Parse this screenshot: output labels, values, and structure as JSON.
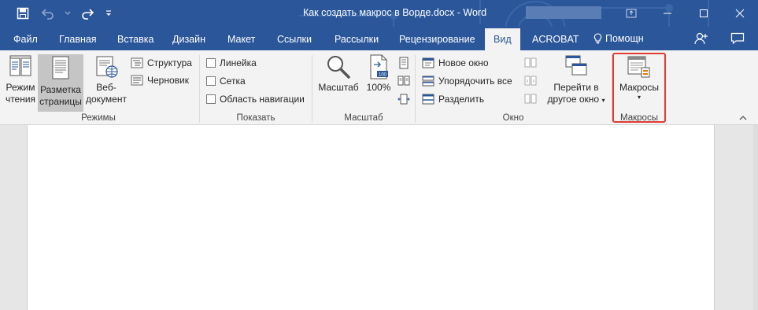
{
  "app": {
    "title": "Как создать макрос в Ворде.docx - Word"
  },
  "quick_access": {
    "icons": [
      "save-icon",
      "undo-icon",
      "undo-dropdown-icon",
      "redo-icon",
      "customize-qat-icon"
    ]
  },
  "window_controls": {
    "icons": [
      "ribbon-display-options-icon",
      "minimize-icon",
      "maximize-icon",
      "close-icon"
    ]
  },
  "tabs": [
    {
      "label": "Файл",
      "active": false
    },
    {
      "label": "Главная",
      "active": false
    },
    {
      "label": "Вставка",
      "active": false
    },
    {
      "label": "Дизайн",
      "active": false
    },
    {
      "label": "Макет",
      "active": false
    },
    {
      "label": "Ссылки",
      "active": false
    },
    {
      "label": "Рассылки",
      "active": false
    },
    {
      "label": "Рецензирование",
      "active": false
    },
    {
      "label": "Вид",
      "active": true
    },
    {
      "label": "ACROBAT",
      "active": false
    }
  ],
  "tell_me": {
    "label": "Помощн",
    "icon": "lightbulb-icon"
  },
  "ribbon": {
    "modes": {
      "label": "Режимы",
      "read_mode": {
        "line1": "Режим",
        "line2": "чтения"
      },
      "print_layout": {
        "line1": "Разметка",
        "line2": "страницы",
        "selected": true
      },
      "web_layout": {
        "line1": "Веб-",
        "line2": "документ"
      },
      "outline": "Структура",
      "draft": "Черновик"
    },
    "show": {
      "label": "Показать",
      "ruler": {
        "label": "Линейка",
        "checked": false
      },
      "gridlines": {
        "label": "Сетка",
        "checked": false
      },
      "nav_pane": {
        "label": "Область навигации",
        "checked": false
      }
    },
    "zoom": {
      "label": "Масштаб",
      "zoom_button": "Масштаб",
      "hundred": "100%",
      "hundred_icon_text": "100"
    },
    "window": {
      "label": "Окно",
      "new_window": "Новое окно",
      "arrange_all": "Упорядочить все",
      "split": "Разделить",
      "switch_windows": {
        "line1": "Перейти в",
        "line2": "другое окно"
      }
    },
    "macros": {
      "label": "Макросы",
      "button": "Макросы",
      "highlight_color": "#e03c31"
    }
  },
  "colors": {
    "word_blue": "#2b579a",
    "ribbon_bg": "#f3f3f3",
    "doc_bg": "#e6e6e6"
  }
}
